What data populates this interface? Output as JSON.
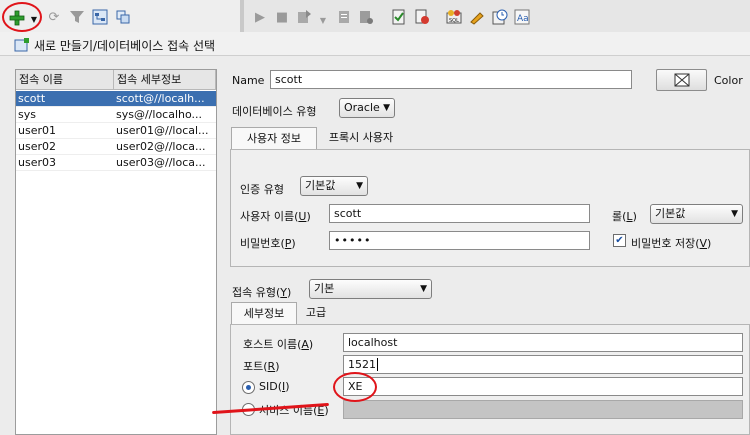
{
  "dialog": {
    "title": "새로 만들기/데이터베이스 접속 선택"
  },
  "connections": {
    "headers": [
      "접속 이름",
      "접속 세부정보"
    ],
    "rows": [
      {
        "name": "scott",
        "details": "scott@//localh...",
        "selected": true
      },
      {
        "name": "sys",
        "details": "sys@//localho..."
      },
      {
        "name": "user01",
        "details": "user01@//local..."
      },
      {
        "name": "user02",
        "details": "user02@//loca..."
      },
      {
        "name": "user03",
        "details": "user03@//loca..."
      }
    ]
  },
  "form": {
    "name_label": "Name",
    "name_value": "scott",
    "color_label": "Color",
    "db_type_label": "데이터베이스 유형",
    "db_type_value": "Oracle",
    "auth_tabs": [
      "사용자 정보",
      "프록시 사용자"
    ],
    "auth_type_label": "인증 유형",
    "auth_type_value": "기본값",
    "username_label": "사용자 이름(",
    "username_mnemonic": "U",
    "username_value": "scott",
    "role_label": "롤(",
    "role_mnemonic": "L",
    "role_value": "기본값",
    "password_label": "비밀번호(",
    "password_mnemonic": "P",
    "password_value": "•••••",
    "save_password_label": "비밀번호 저장(",
    "save_password_mnemonic": "V",
    "save_password_checked": true,
    "conn_type_label": "접속 유형(",
    "conn_type_mnemonic": "Y",
    "conn_type_value": "기본",
    "detail_tabs": [
      "세부정보",
      "고급"
    ],
    "host_label": "호스트 이름(",
    "host_mnemonic": "A",
    "host_value": "localhost",
    "port_label": "포트(",
    "port_mnemonic": "R",
    "port_value": "1521",
    "sid_label": "SID(",
    "sid_mnemonic": "I",
    "sid_value": "XE",
    "sid_selected": true,
    "service_label": "서비스 이름(",
    "service_mnemonic": "E",
    "service_value": ""
  },
  "toolbar": {
    "icons": [
      "add-connection-icon",
      "refresh-icon",
      "filter-icon",
      "schema-browser-icon",
      "run-icon",
      "stop-icon",
      "commit-icon",
      "rollback-icon",
      "sql-icon",
      "autotrace-icon",
      "eraser-icon",
      "history-icon",
      "format-icon"
    ]
  },
  "annotation_color": "#e0141a",
  "selection_color": "#3b6fb0"
}
